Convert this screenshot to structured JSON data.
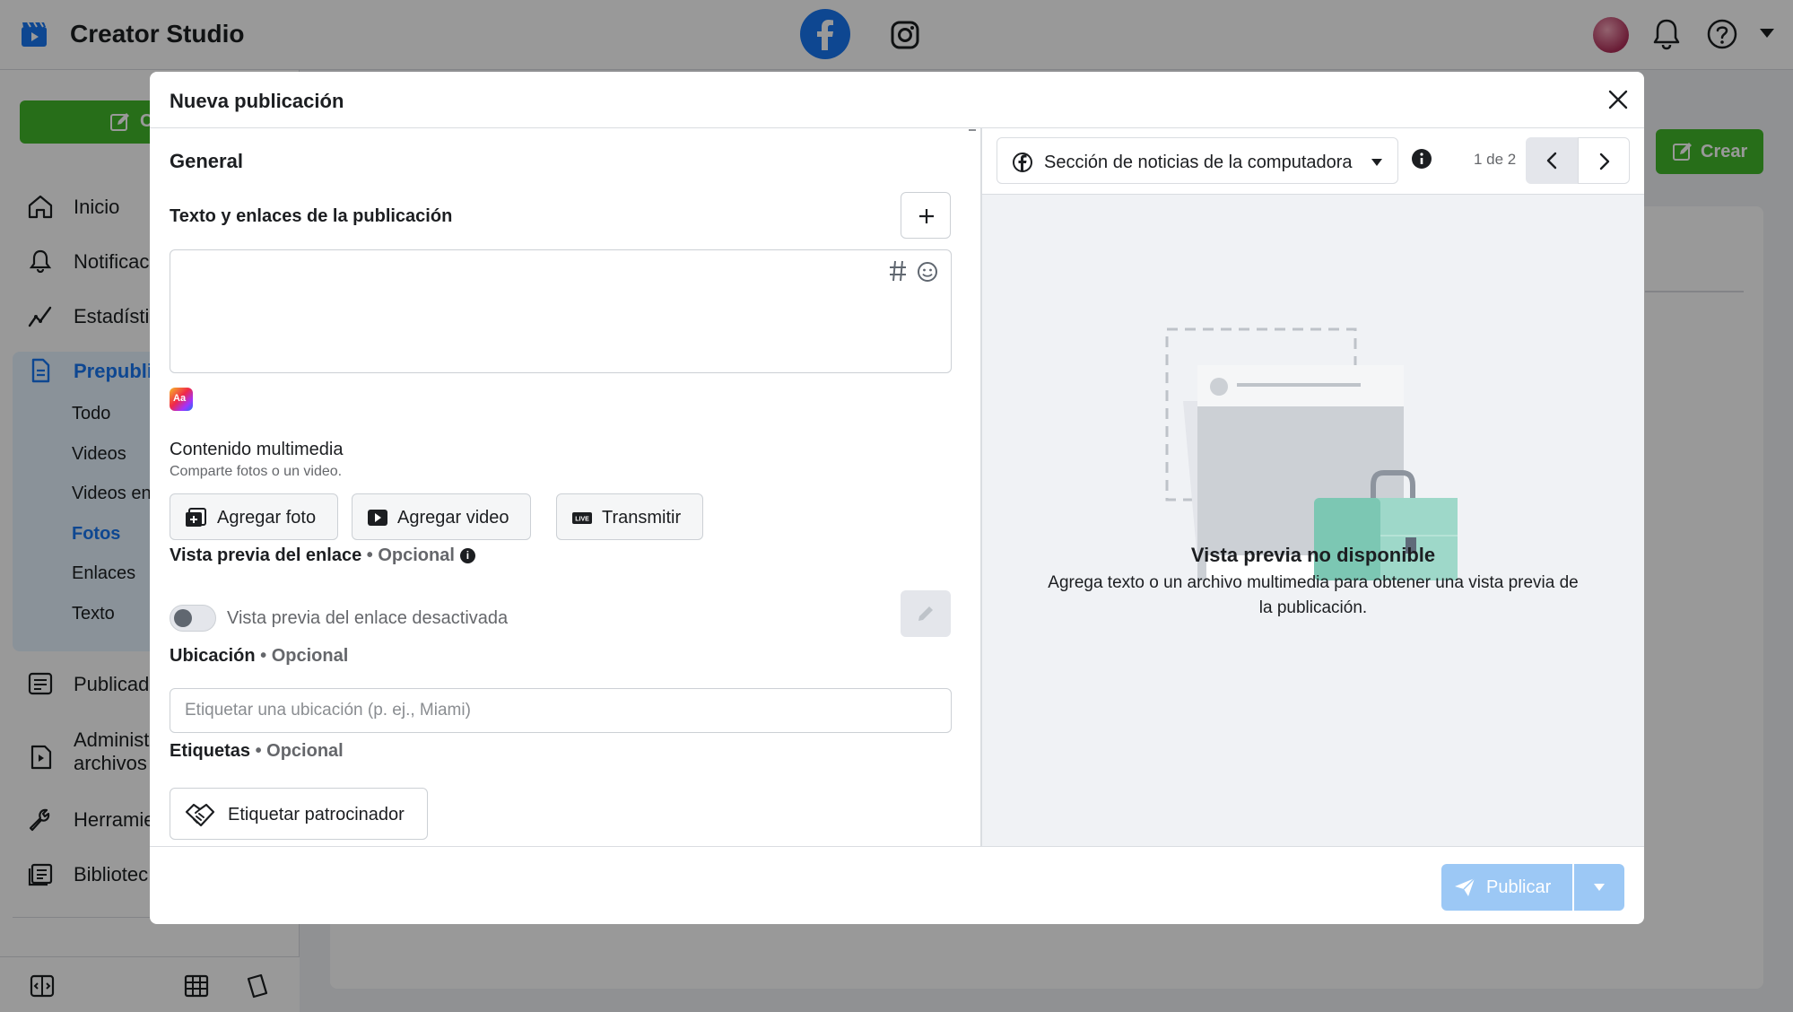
{
  "topbar": {
    "app_title": "Creator Studio",
    "icons": [
      "clapperboard-icon",
      "facebook-icon",
      "instagram-icon",
      "avatar",
      "bell-icon",
      "help-icon",
      "caret-down-icon"
    ]
  },
  "sidebar": {
    "create_label": "C",
    "items": [
      {
        "label": "Inicio",
        "icon": "home-icon"
      },
      {
        "label": "Notificac",
        "icon": "bell-icon"
      },
      {
        "label": "Estadísti",
        "icon": "insights-icon"
      },
      {
        "label": "Prepubli",
        "icon": "document-icon"
      },
      {
        "label": "Publicad",
        "icon": "posts-icon"
      },
      {
        "label": "Administ archivos",
        "icon": "content-library-icon"
      },
      {
        "label": "Herramie",
        "icon": "wrench-icon"
      },
      {
        "label": "Bibliotec",
        "icon": "library-icon"
      }
    ],
    "sub_items": [
      "Todo",
      "Videos",
      "Videos en",
      "Fotos",
      "Enlaces",
      "Texto"
    ],
    "active_sub": "Fotos"
  },
  "background": {
    "create_button": "Crear"
  },
  "modal": {
    "title": "Nueva publicación",
    "section_title": "General",
    "post_text_label": "Texto y enlaces de la publicación",
    "media": {
      "label": "Contenido multimedia",
      "help": "Comparte fotos o un video.",
      "buttons": [
        "Agregar foto",
        "Agregar video",
        "Transmitir"
      ]
    },
    "link_preview": {
      "label": "Vista previa del enlace",
      "optional": "Opcional",
      "toggle_label": "Vista previa del enlace desactivada",
      "toggle_on": false
    },
    "location": {
      "label": "Ubicación",
      "optional": "Opcional",
      "placeholder": "Etiquetar una ubicación (p. ej., Miami)",
      "value": ""
    },
    "tags": {
      "label": "Etiquetas",
      "optional": "Opcional",
      "sponsor_button": "Etiquetar patrocinador"
    },
    "preview": {
      "placement": "Sección de noticias de la computadora",
      "pager": "1 de 2",
      "title": "Vista previa no disponible",
      "description": "Agrega texto o un archivo multimedia para obtener una vista previa de la publicación."
    },
    "footer": {
      "publish_label": "Publicar"
    }
  },
  "colors": {
    "brand_blue": "#1877f2",
    "create_green": "#42b72a",
    "publish_disabled": "#9cc8f5"
  }
}
